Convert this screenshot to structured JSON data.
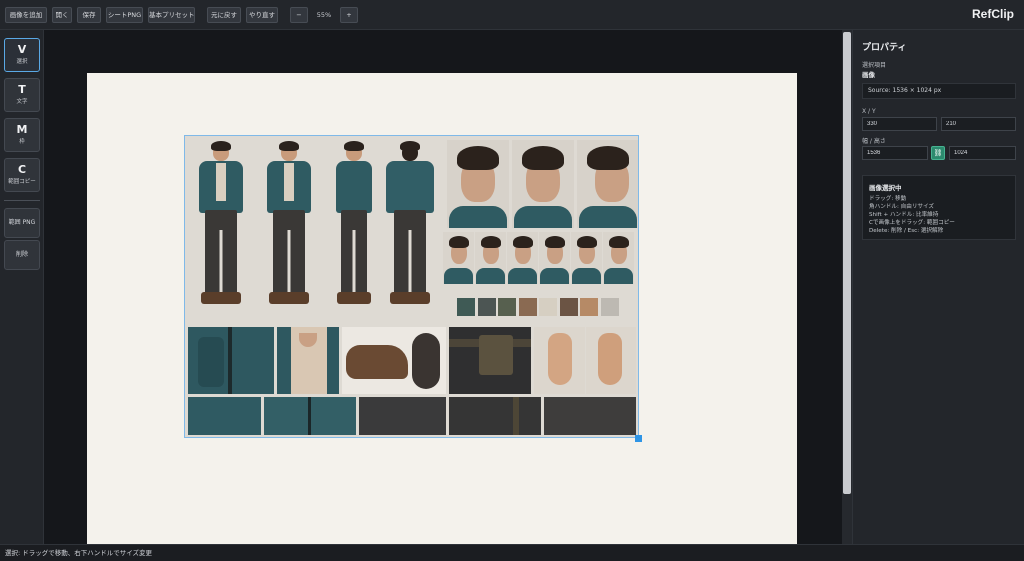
{
  "toolbar": {
    "add_image": "画像を追加",
    "open": "開く",
    "save": "保存",
    "sheet_png": "シートPNG",
    "basic_preset": "基本プリセット",
    "undo": "元に戻す",
    "redo": "やり直す",
    "zoom_out": "−",
    "zoom_level": "55%",
    "zoom_in": "+",
    "brand": "RefClip"
  },
  "tools": [
    {
      "key": "V",
      "label": "選択",
      "active": true
    },
    {
      "key": "T",
      "label": "文字"
    },
    {
      "key": "M",
      "label": "枠"
    },
    {
      "key": "C",
      "label": "範囲コピー"
    }
  ],
  "tool_actions": {
    "range_png": "範囲 PNG",
    "delete": "削除"
  },
  "properties": {
    "title": "プロパティ",
    "selected_label": "選択項目",
    "selected_value": "画像",
    "source": "Source: 1536 × 1024 px",
    "xy_label": "X / Y",
    "x": "330",
    "y": "210",
    "wh_label": "幅 / 高さ",
    "width": "1536",
    "height": "1024",
    "help_title": "画像選択中",
    "help_lines": [
      "ドラッグ: 移動",
      "角ハンドル: 自由リサイズ",
      "Shift + ハンドル: 比率維持",
      "Cで画像上をドラッグ: 範囲コピー",
      "Delete: 削除 / Esc: 選択解除"
    ]
  },
  "status": "選択: ドラッグで移動、右下ハンドルでサイズ変更",
  "colors": {
    "swatches": [
      "#3f5a55",
      "#4c5553",
      "#57604f",
      "#8a6a52",
      "#d6cfc2",
      "#6b5444",
      "#b68a66",
      "#bdb9b2"
    ],
    "accent": "#2e95e6",
    "jacket": "#2f5b62"
  }
}
